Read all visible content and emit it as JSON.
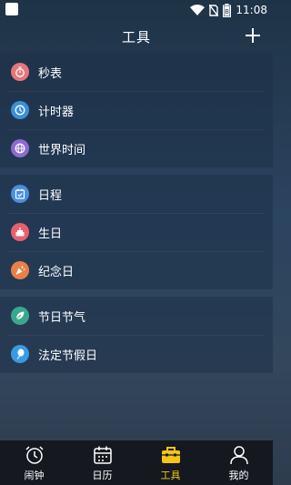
{
  "status_bar": {
    "time": "11:08",
    "battery_level": "B"
  },
  "header": {
    "title": "工具",
    "add_icon": "plus-icon"
  },
  "groups": [
    {
      "items": [
        {
          "label": "秒表",
          "icon": "stopwatch-icon",
          "color": "#e8757b"
        },
        {
          "label": "计时器",
          "icon": "clock-icon",
          "color": "#3d8fd6"
        },
        {
          "label": "世界时间",
          "icon": "globe-icon",
          "color": "#8f6ad0"
        }
      ]
    },
    {
      "items": [
        {
          "label": "日程",
          "icon": "schedule-icon",
          "color": "#4a8fe0"
        },
        {
          "label": "生日",
          "icon": "cake-icon",
          "color": "#e86070"
        },
        {
          "label": "纪念日",
          "icon": "party-icon",
          "color": "#e8804a"
        }
      ]
    },
    {
      "items": [
        {
          "label": "节日节气",
          "icon": "leaf-icon",
          "color": "#3aa88c"
        },
        {
          "label": "法定节假日",
          "icon": "balloon-icon",
          "color": "#3a9be0"
        }
      ]
    }
  ],
  "tabs": [
    {
      "label": "闹钟",
      "icon": "alarm-clock-icon",
      "active": false
    },
    {
      "label": "日历",
      "icon": "calendar-icon",
      "active": false
    },
    {
      "label": "工具",
      "icon": "toolbox-icon",
      "active": true
    },
    {
      "label": "我的",
      "icon": "person-icon",
      "active": false
    }
  ],
  "colors": {
    "active_tab": "#f5c518",
    "tabbar_bg": "#15191f"
  }
}
